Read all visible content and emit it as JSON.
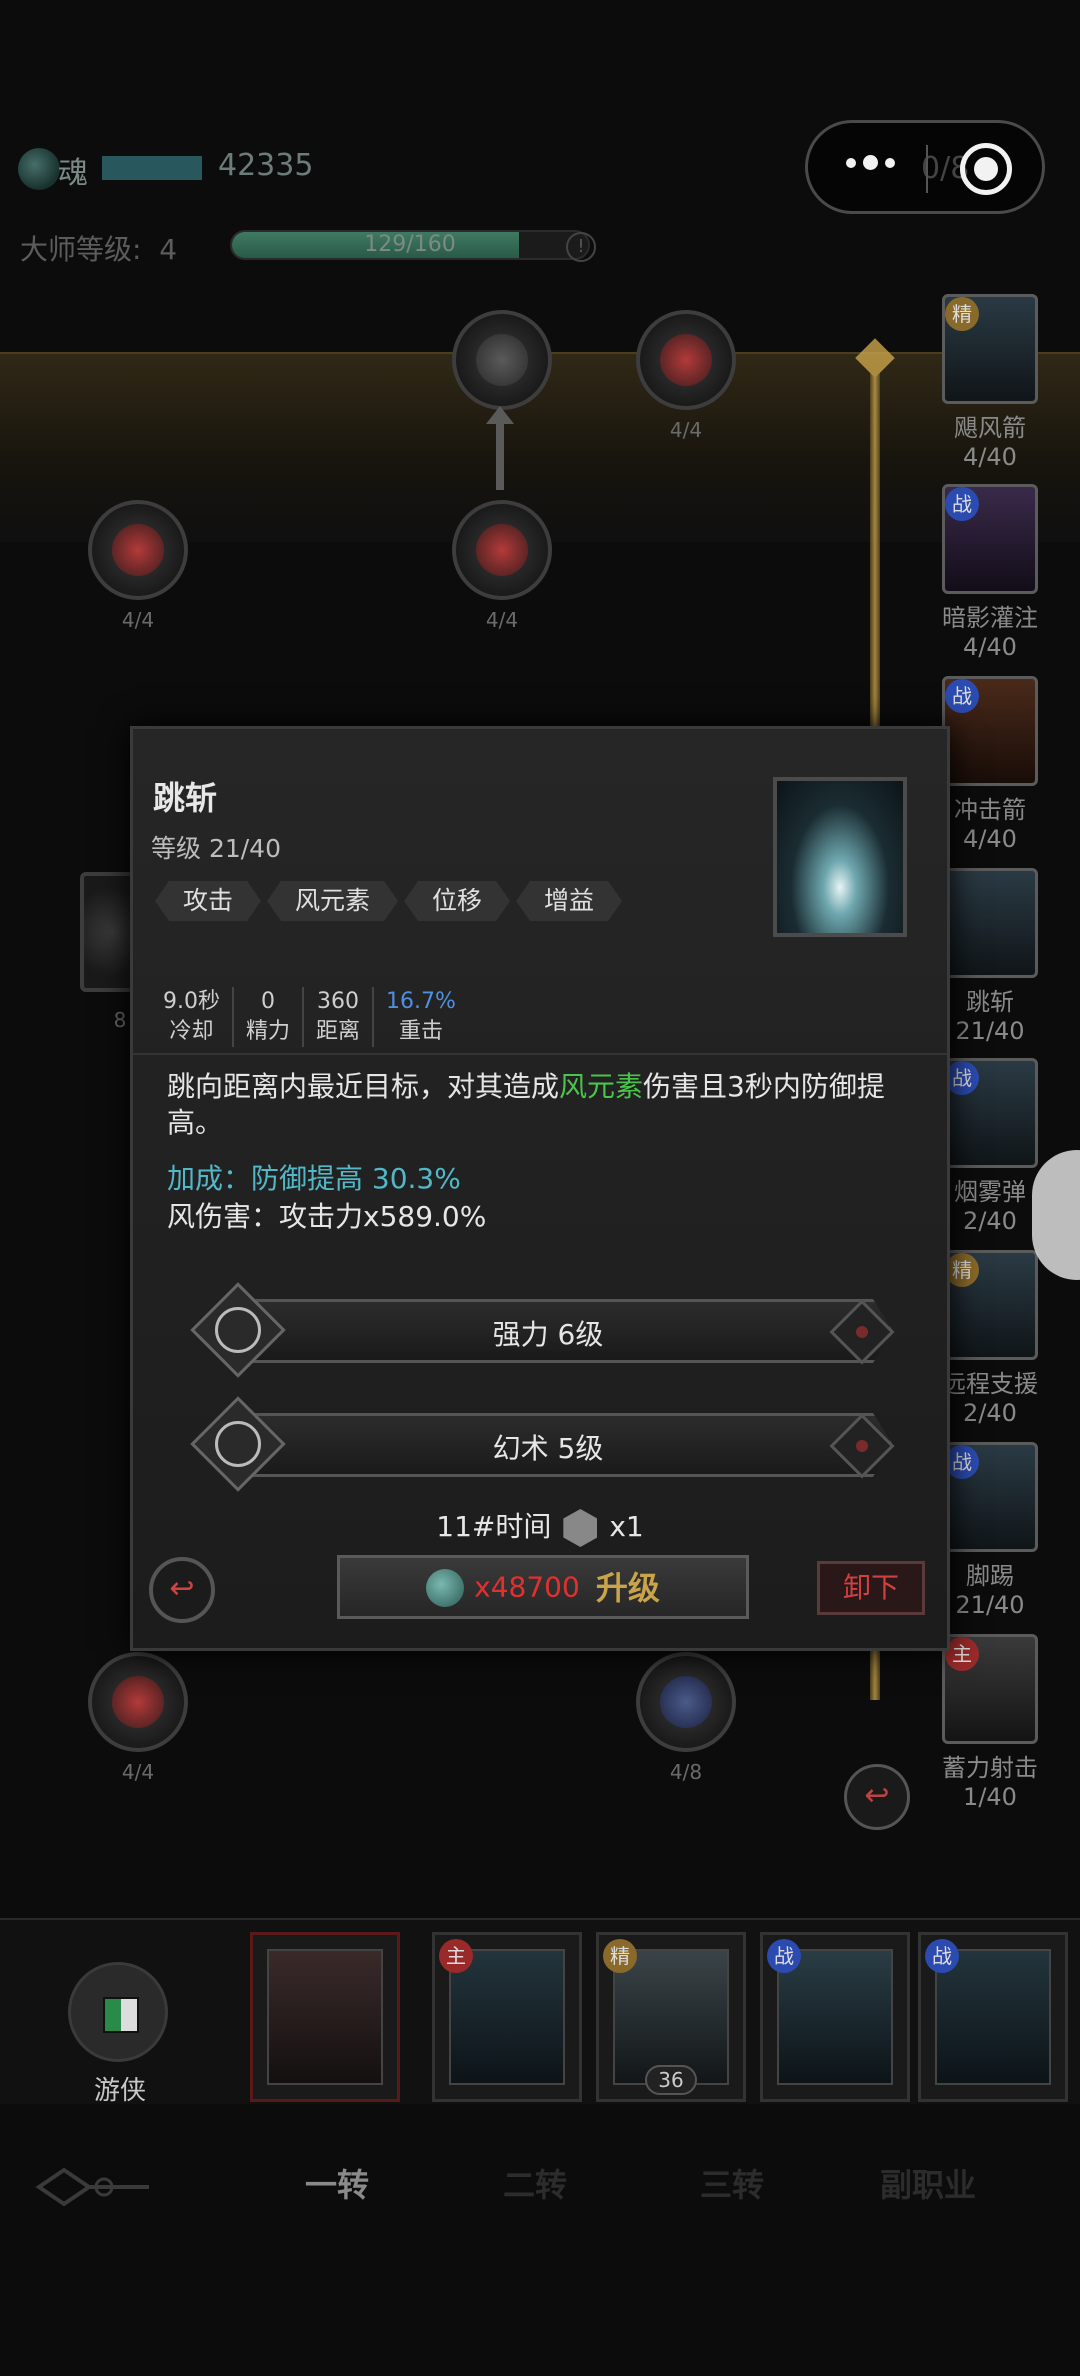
{
  "topbar": {
    "soul_label": "魂",
    "soul_value": "42335",
    "capsule_ghost": "0/8",
    "master_label": "大师等级:",
    "master_level": "4",
    "master_progress": "129/160",
    "master_progress_fraction": 0.806
  },
  "tree_nodes": [
    {
      "label": "4/4"
    },
    {
      "label": "4/4"
    },
    {
      "label": "4/4"
    },
    {
      "label": "4/4"
    },
    {
      "label": "4/4"
    },
    {
      "label": "4/8"
    },
    {
      "label": "8"
    }
  ],
  "right_skills": [
    {
      "tag": "精",
      "name": "飓风箭",
      "level": "4/40"
    },
    {
      "tag": "战",
      "name": "暗影灌注",
      "level": "4/40"
    },
    {
      "tag": "战",
      "name": "冲击箭",
      "level": "4/40"
    },
    {
      "tag": "",
      "name": "跳斩",
      "level": "21/40"
    },
    {
      "tag": "",
      "name": "烟雾弹",
      "level": "2/40"
    },
    {
      "tag": "精",
      "name": "远程支援",
      "level": "2/40"
    },
    {
      "tag": "战",
      "name": "脚踢",
      "level": "21/40"
    },
    {
      "tag": "主",
      "name": "蓄力射击",
      "level": "1/40"
    }
  ],
  "popup": {
    "title": "跳斩",
    "level": "等级 21/40",
    "tags": [
      "攻击",
      "风元素",
      "位移",
      "增益"
    ],
    "stats": [
      {
        "value": "9.0秒",
        "key": "冷却"
      },
      {
        "value": "0",
        "key": "精力"
      },
      {
        "value": "360",
        "key": "距离"
      },
      {
        "value": "16.7%",
        "key": "重击"
      }
    ],
    "desc_pre": "跳向距离内最近目标，对其造成",
    "desc_wind": "风元素",
    "desc_post": "伤害且3秒内防御提高。",
    "bonus": "加成：防御提高 30.3%",
    "damage": "风伤害：攻击力x589.0%",
    "runes": [
      "强力 6级",
      "幻术 5级"
    ],
    "cost_label": "11#时间",
    "cost_qty": "x1",
    "upgrade_price": "x48700",
    "upgrade_label": "升级",
    "unequip_label": "卸下",
    "back_icon": "↩"
  },
  "slotbar": {
    "class_name": "游侠",
    "slots": [
      {
        "tag": "",
        "count": ""
      },
      {
        "tag": "主",
        "count": ""
      },
      {
        "tag": "精",
        "count": "36"
      },
      {
        "tag": "战",
        "count": ""
      },
      {
        "tag": "战",
        "count": ""
      }
    ]
  },
  "nav": {
    "tabs": [
      "一转",
      "二转",
      "三转",
      "副职业"
    ],
    "active": 0
  },
  "colors": {
    "wind_green": "#4bc44b",
    "bonus_cyan": "#52b8c8",
    "crit_blue": "#4f8fe0",
    "price_red": "#e03030",
    "upgrade_gold": "#c9a44a"
  }
}
